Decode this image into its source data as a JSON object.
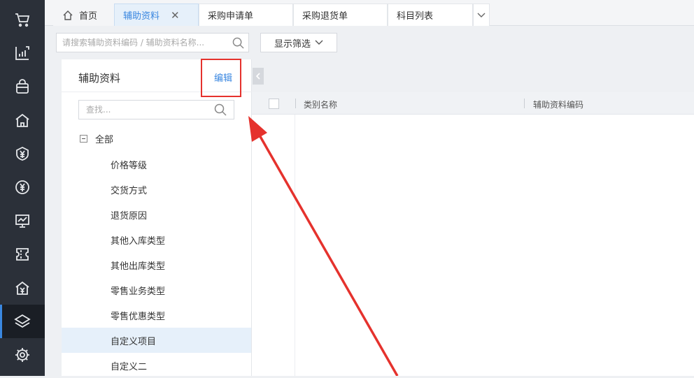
{
  "sidenav": {
    "items": [
      {
        "icon": "cart-icon"
      },
      {
        "icon": "chart-icon"
      },
      {
        "icon": "bag-icon"
      },
      {
        "icon": "warehouse-icon"
      },
      {
        "icon": "yen-shield-icon"
      },
      {
        "icon": "yen-circle-icon"
      },
      {
        "icon": "presentation-icon"
      },
      {
        "icon": "ticket-icon"
      },
      {
        "icon": "yen-house-icon"
      },
      {
        "icon": "layers-icon",
        "active": true
      },
      {
        "icon": "gear-icon"
      }
    ]
  },
  "tabs": [
    {
      "label": "首页"
    },
    {
      "label": "辅助资料",
      "active": true
    },
    {
      "label": "采购申请单"
    },
    {
      "label": "采购退货单"
    },
    {
      "label": "科目列表"
    }
  ],
  "toolbar": {
    "search_placeholder": "请搜索辅助资料编码 / 辅助资料名称...",
    "filter_label": "显示筛选"
  },
  "panel": {
    "title": "辅助资料",
    "edit_label": "编辑",
    "search_placeholder": "查找...",
    "root_label": "全部",
    "items": [
      {
        "label": "价格等级"
      },
      {
        "label": "交货方式"
      },
      {
        "label": "退货原因"
      },
      {
        "label": "其他入库类型"
      },
      {
        "label": "其他出库类型"
      },
      {
        "label": "零售业务类型"
      },
      {
        "label": "零售优惠类型"
      },
      {
        "label": "自定义项目",
        "selected": true
      },
      {
        "label": "自定义二"
      }
    ]
  },
  "grid": {
    "columns": [
      {
        "label": "类别名称"
      },
      {
        "label": "辅助资料编码"
      }
    ]
  },
  "colors": {
    "accent": "#3a87e0",
    "annotation": "#e5322d",
    "sidebar_bg": "#2b3039"
  }
}
